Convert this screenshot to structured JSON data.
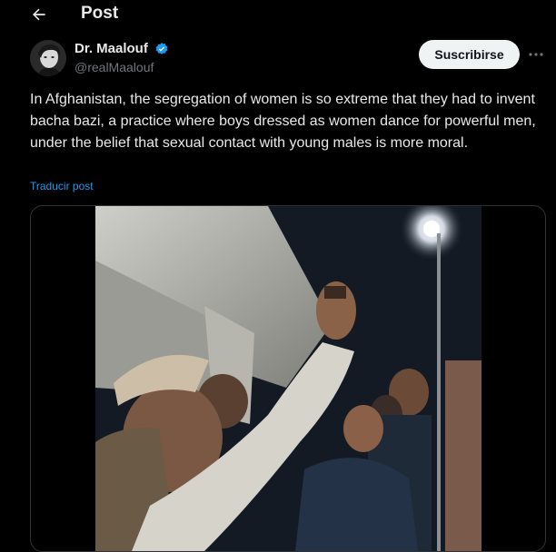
{
  "header": {
    "title": "Post"
  },
  "icons": {
    "back": "arrow-left-icon",
    "verified": "verified-badge-icon",
    "more": "more-horizontal-icon"
  },
  "colors": {
    "accent": "#1d9bf0",
    "text": "#e7e9ea",
    "muted": "#71767b",
    "background": "#000000"
  },
  "post": {
    "author_name": "Dr. Maalouf",
    "author_handle": "@realMaalouf",
    "subscribe_label": "Suscribirse",
    "text": "In Afghanistan, the segregation of women is so extreme that they had to invent bacha bazi, a practice where boys dressed as women dance for powerful men, under the belief that sexual contact with young males is more moral.",
    "translate_label": "Traducir post"
  }
}
